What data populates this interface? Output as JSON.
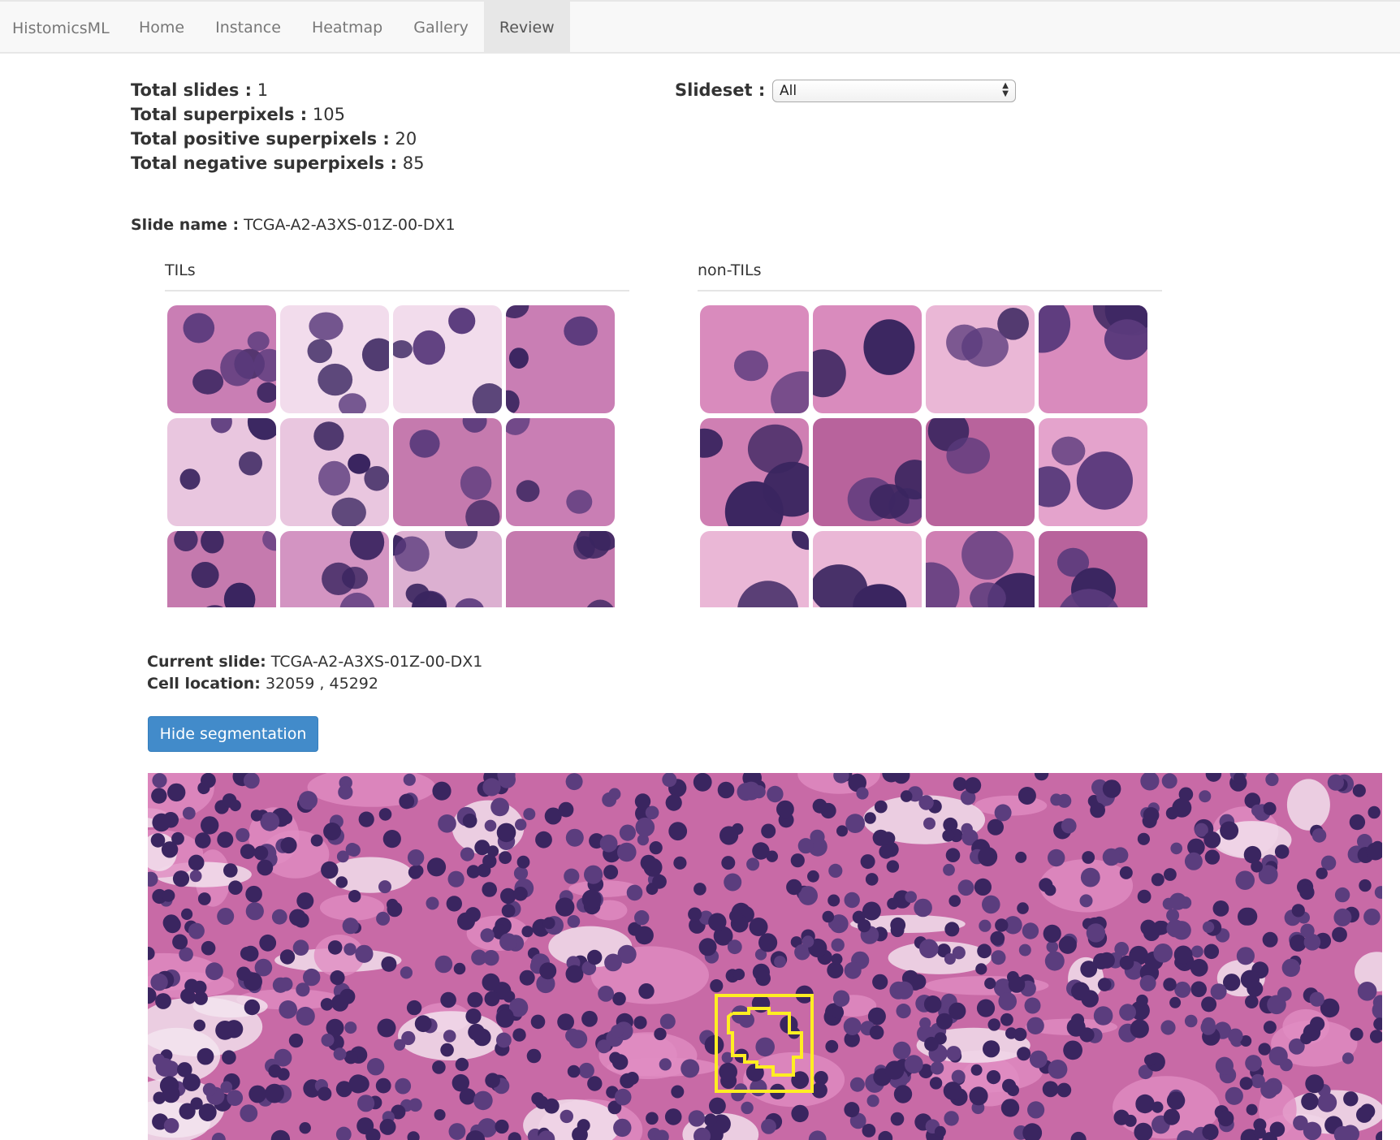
{
  "navbar": {
    "brand": "HistomicsML",
    "items": [
      {
        "label": "Home",
        "active": false
      },
      {
        "label": "Instance",
        "active": false
      },
      {
        "label": "Heatmap",
        "active": false
      },
      {
        "label": "Gallery",
        "active": false
      },
      {
        "label": "Review",
        "active": true
      }
    ]
  },
  "stats": {
    "total_slides_label": "Total slides :",
    "total_slides": "1",
    "total_superpixels_label": "Total superpixels :",
    "total_superpixels": "105",
    "total_positive_label": "Total positive superpixels :",
    "total_positive": "20",
    "total_negative_label": "Total negative superpixels :",
    "total_negative": "85"
  },
  "slideset": {
    "label": "Slideset :",
    "selected": "All"
  },
  "slide_name": {
    "label": "Slide name :",
    "value": "TCGA-A2-A3XS-01Z-00-DX1"
  },
  "galleries": {
    "tils": {
      "title": "TILs"
    },
    "non_tils": {
      "title": "non-TILs"
    }
  },
  "current": {
    "slide_label": "Current slide:",
    "slide_value": "TCGA-A2-A3XS-01Z-00-DX1",
    "location_label": "Cell location:",
    "location_value": "32059 , 45292"
  },
  "controls": {
    "hide_segmentation_label": "Hide segmentation"
  },
  "colors": {
    "navbar_bg": "#f8f8f8",
    "active_tab_bg": "#e7e7e7",
    "button_bg": "#428bca",
    "tissue_bg": "#c86aa6",
    "nucleus": "#3a2560",
    "segmentation_outline": "#ffee22"
  }
}
